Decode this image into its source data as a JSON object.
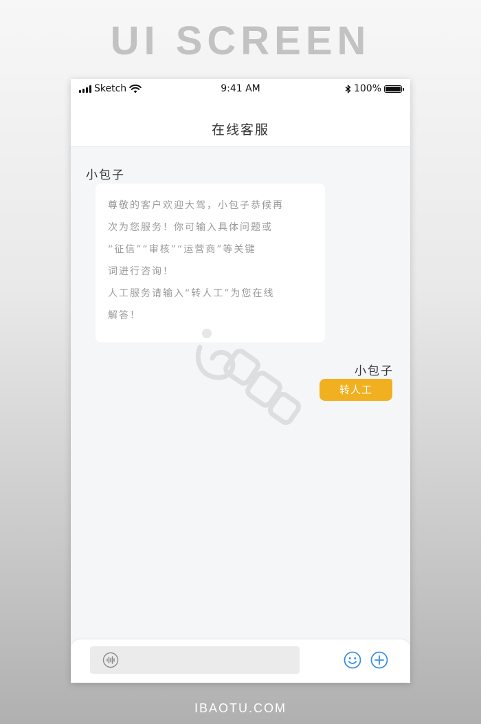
{
  "poster": {
    "title": "UI SCREEN",
    "footer": "IBAOTU.COM"
  },
  "status_bar": {
    "carrier": "Sketch",
    "time": "9:41 AM",
    "battery": "100%",
    "icons": [
      "signal-icon",
      "wifi-icon",
      "bluetooth-icon",
      "battery-icon"
    ]
  },
  "nav": {
    "title": "在线客服"
  },
  "messages": [
    {
      "sender": "小包子",
      "side": "left",
      "lines": [
        "尊敬的客户欢迎大驾，小包子恭候再",
        "次为您服务！你可输入具体问题或",
        "“征信”“审核”“运营商”等关键",
        "词进行咨询！",
        "人工服务请输入“转人工”为您在线",
        "解答！"
      ]
    },
    {
      "sender": "小包子",
      "side": "right",
      "text": "转人工",
      "bubble_color": "#f0b020"
    }
  ],
  "input_bar": {
    "icons": [
      "voice-icon",
      "emoji-icon",
      "add-icon"
    ],
    "accent_color": "#3a8ee6"
  }
}
